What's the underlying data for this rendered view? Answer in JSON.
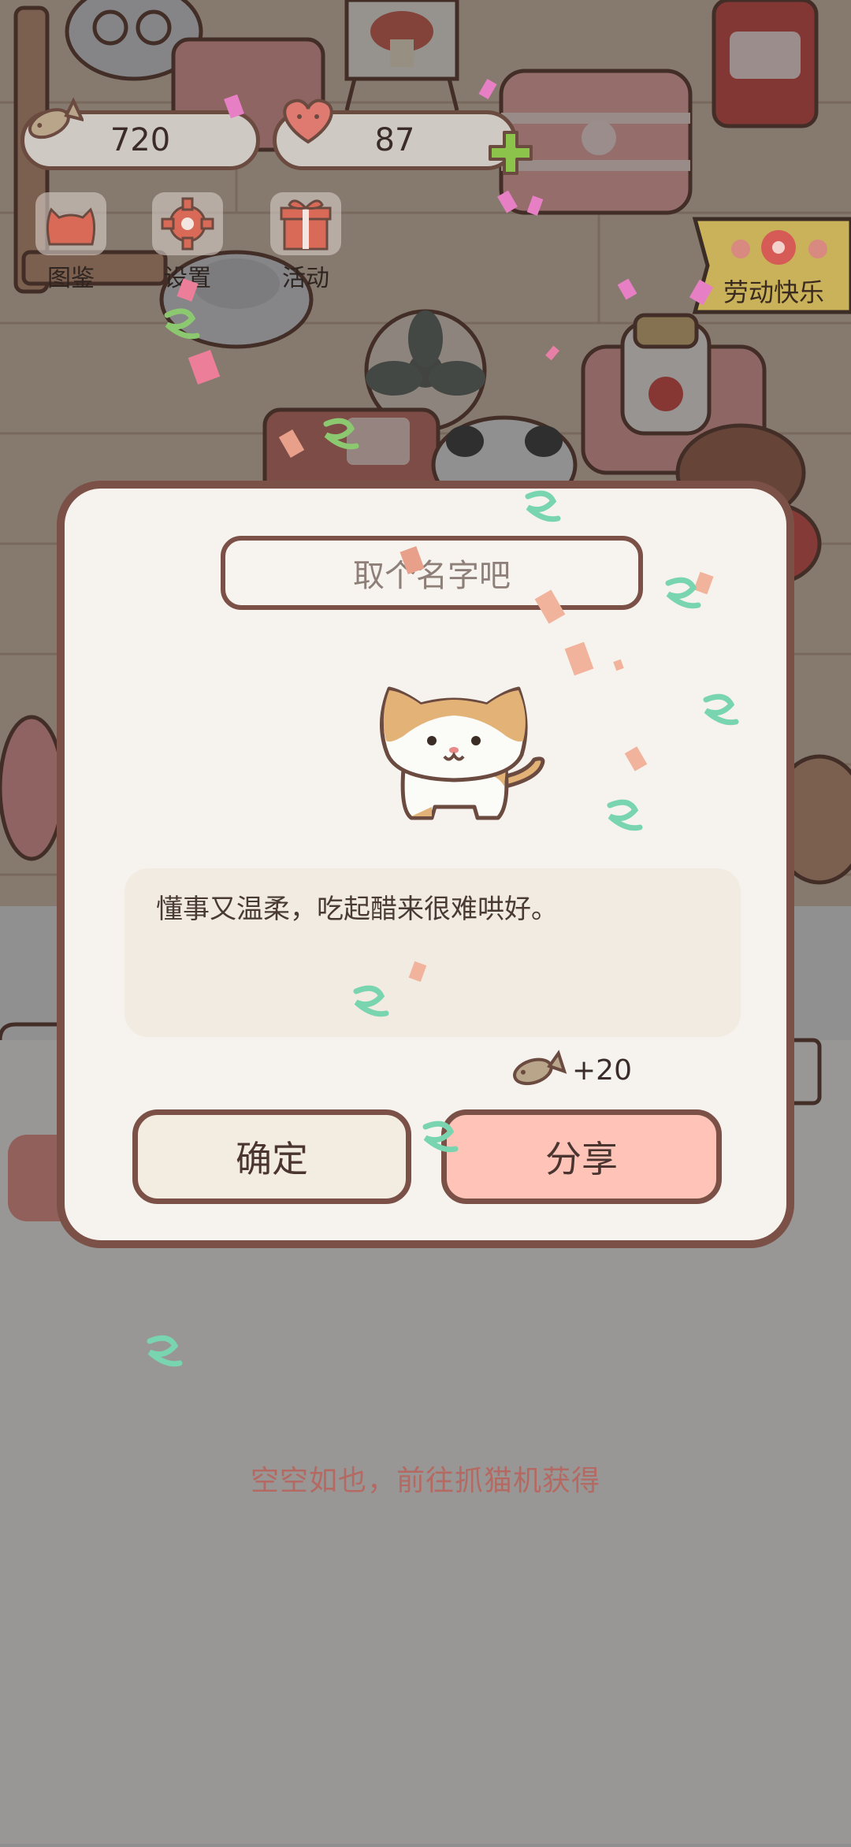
{
  "hud": {
    "fish_count": "720",
    "heart_count": "87",
    "buttons": [
      {
        "label": "图鉴",
        "icon": "cat-face-icon"
      },
      {
        "label": "设置",
        "icon": "gear-icon"
      },
      {
        "label": "活动",
        "icon": "gift-icon"
      }
    ],
    "banner_label": "劳动快乐"
  },
  "background": {
    "empty_text": "空空如也，前往抓猫机获得"
  },
  "dialog": {
    "name_placeholder": "取个名字吧",
    "description": "懂事又温柔，吃起醋来很难哄好。",
    "reward_amount": "+20",
    "confirm_label": "确定",
    "share_label": "分享"
  },
  "colors": {
    "accent_border": "#7a5047",
    "share_button": "#ffc3b7",
    "confirm_button": "#f3ece0",
    "plus_button": "#8cc34a"
  }
}
